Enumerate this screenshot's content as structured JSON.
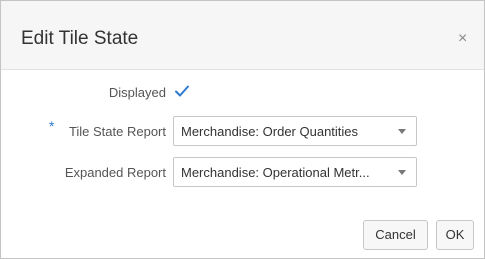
{
  "dialog": {
    "title": "Edit Tile State",
    "close_glyph": "×"
  },
  "form": {
    "displayed": {
      "label": "Displayed",
      "checked": true,
      "check_color": "#2e7bcf"
    },
    "tile_state_report": {
      "required_marker": "*",
      "label": "Tile State Report",
      "value": "Merchandise: Order Quantities"
    },
    "expanded_report": {
      "label": "Expanded Report",
      "value": "Merchandise: Operational Metr..."
    }
  },
  "buttons": {
    "cancel": "Cancel",
    "ok": "OK"
  }
}
